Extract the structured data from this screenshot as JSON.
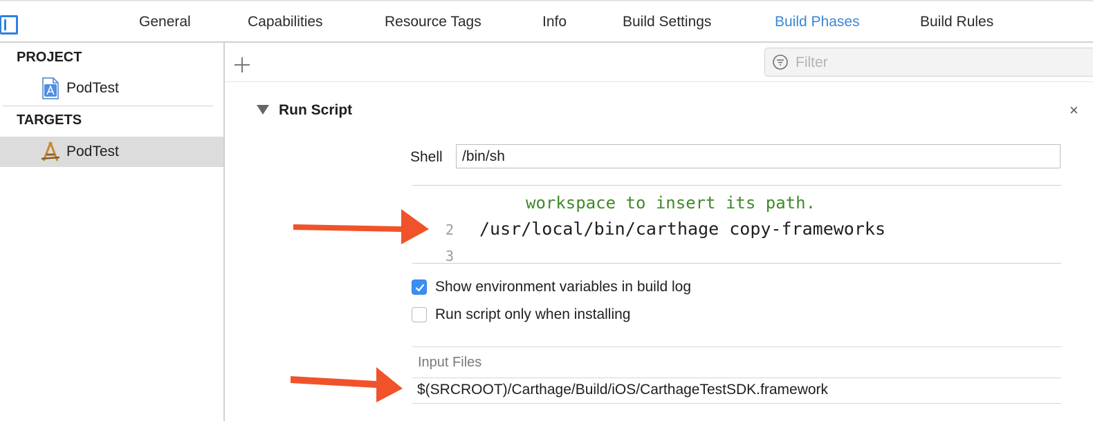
{
  "tabs": [
    {
      "label": "General",
      "active": false
    },
    {
      "label": "Capabilities",
      "active": false
    },
    {
      "label": "Resource Tags",
      "active": false
    },
    {
      "label": "Info",
      "active": false
    },
    {
      "label": "Build Settings",
      "active": false
    },
    {
      "label": "Build Phases",
      "active": true
    },
    {
      "label": "Build Rules",
      "active": false
    }
  ],
  "navigator": {
    "project_heading": "PROJECT",
    "project_item": "PodTest",
    "targets_heading": "TARGETS",
    "target_item": "PodTest"
  },
  "filter": {
    "placeholder": "Filter"
  },
  "phase": {
    "title": "Run Script",
    "delete_glyph": "×",
    "shell_label": "Shell",
    "shell_value": "/bin/sh",
    "script": {
      "comment_line": "workspace to insert its path.",
      "lines": [
        {
          "number": "2",
          "text": "/usr/local/bin/carthage copy-frameworks"
        },
        {
          "number": "3",
          "text": ""
        }
      ]
    },
    "options": [
      {
        "label": "Show environment variables in build log",
        "checked": true
      },
      {
        "label": "Run script only when installing",
        "checked": false
      }
    ],
    "input_files": {
      "title": "Input Files",
      "items": [
        "$(SRCROOT)/Carthage/Build/iOS/CarthageTestSDK.framework"
      ]
    }
  },
  "colors": {
    "accent": "#3b87d4",
    "arrow": "#f0532a",
    "comment": "#3e8a2a",
    "selection": "#dcdcdc"
  }
}
